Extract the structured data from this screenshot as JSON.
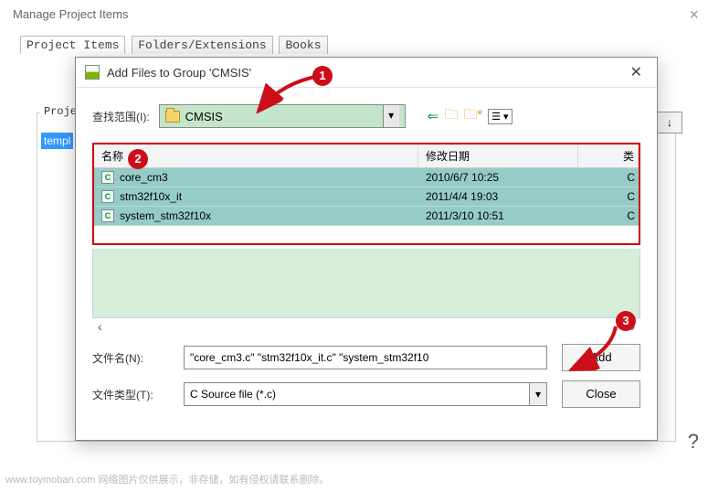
{
  "outer": {
    "title": "Manage Project Items",
    "tabs": [
      "Project Items",
      "Folders/Extensions",
      "Books"
    ],
    "project_label_frag": "Proje",
    "project_cell_frag": "templ",
    "arrow_down": "↓"
  },
  "dialog": {
    "title": "Add Files to Group 'CMSIS'",
    "close_x": "✕",
    "lookup_label": "查找范围(I):",
    "folder": "CMSIS",
    "combo_arrow": "▾",
    "nav": {
      "back": "⇐",
      "up_folder": "🗀",
      "new_folder": "🗀*",
      "view_menu": "☰ ▾"
    },
    "columns": {
      "name": "名称",
      "date": "修改日期",
      "type": "类"
    },
    "files": [
      {
        "name": "core_cm3",
        "date": "2010/6/7 10:25",
        "type": "C "
      },
      {
        "name": "stm32f10x_it",
        "date": "2011/4/4 19:03",
        "type": "C "
      },
      {
        "name": "system_stm32f10x",
        "date": "2011/3/10 10:51",
        "type": "C "
      }
    ],
    "scroll": {
      "left": "‹",
      "right": "›"
    },
    "filename_label": "文件名(N):",
    "filename_value": "\"core_cm3.c\" \"stm32f10x_it.c\" \"system_stm32f10",
    "filetype_label": "文件类型(T):",
    "filetype_value": "C Source file (*.c)",
    "add_btn": "Add",
    "close_btn": "Close"
  },
  "annotations": {
    "b1": "1",
    "b2": "2",
    "b3": "3"
  },
  "footer": "www.toymoban.com 网络图片仅供展示，非存储，如有侵权请联系删除。",
  "help": "?"
}
